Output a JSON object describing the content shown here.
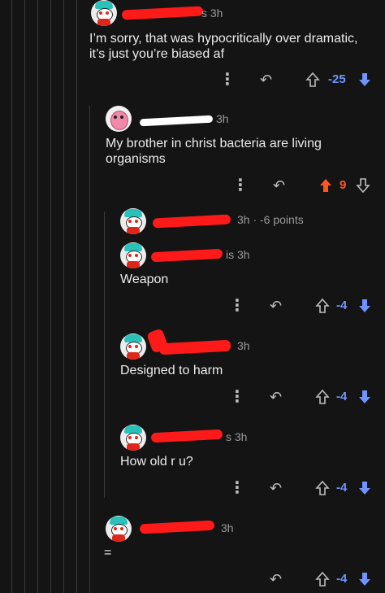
{
  "thread": {
    "comments": [
      {
        "time": "3h",
        "time_prefix": "s",
        "body_line1": "I’m sorry, that was hypocritically over dramatic,",
        "body_line2": "it’s just you’re biased af",
        "score": "-25",
        "vote": "down"
      },
      {
        "time": "3h",
        "body_line1": "My brother in christ bacteria are living",
        "body_line2": "organisms",
        "score": "9",
        "vote": "up"
      },
      {
        "time": "3h · -6 points",
        "collapsed": true
      },
      {
        "time": "3h",
        "time_prefix": "is",
        "body_line1": "Weapon",
        "score": "-4",
        "vote": "down"
      },
      {
        "time": "3h",
        "body_line1": "Designed to harm",
        "score": "-4",
        "vote": "down"
      },
      {
        "time": "3h",
        "time_prefix": "s",
        "body_line1": "How old r u?",
        "score": "-4",
        "vote": "down"
      },
      {
        "time": "3h",
        "body_line1": "=",
        "score": "-4",
        "vote": "down"
      }
    ]
  },
  "icons": {
    "more": "⋮",
    "reply": "↶"
  },
  "colors": {
    "background": "#141414",
    "downvote": "#6f94ff",
    "upvote": "#ff5722",
    "redaction": "#ff1a1a"
  }
}
